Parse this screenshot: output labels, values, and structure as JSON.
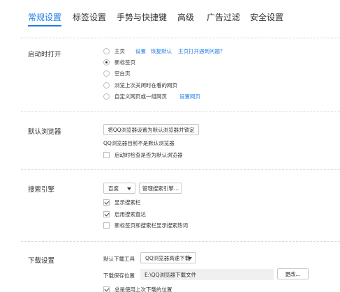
{
  "tabs": [
    {
      "label": "常规设置",
      "active": true
    },
    {
      "label": "标签设置",
      "active": false
    },
    {
      "label": "手势与快捷键",
      "active": false
    },
    {
      "label": "高级",
      "active": false
    },
    {
      "label": "广告过滤",
      "active": false
    },
    {
      "label": "安全设置",
      "active": false
    }
  ],
  "accent_color": "#1e7be8",
  "startup": {
    "title": "启动时打开",
    "options": [
      {
        "label": "主页",
        "checked": false
      },
      {
        "label": "新标签页",
        "checked": true
      },
      {
        "label": "空白页",
        "checked": false
      },
      {
        "label": "浏览上次关闭时在看的网页",
        "checked": false
      },
      {
        "label": "自定义网页或一组网页",
        "checked": false
      }
    ],
    "home_links": {
      "settings": "设置",
      "restore_default": "恢复默认",
      "help": "主页打开遇到问题？"
    },
    "custom_settings_link": "设置网页"
  },
  "default_browser": {
    "title": "默认浏览器",
    "button": "将QQ浏览器设置为默认浏览器并锁定",
    "status": "QQ浏览器目前不是默认浏览器",
    "check_on_startup": {
      "label": "启动时检查是否为默认浏览器",
      "checked": false
    }
  },
  "search": {
    "title": "搜索引擎",
    "engine": "百度",
    "manage_button": "管理搜索引擎...",
    "options": [
      {
        "label": "显示搜索栏",
        "checked": true
      },
      {
        "label": "启用搜索直达",
        "checked": true
      },
      {
        "label": "新标签页和搜索栏显示搜索热词",
        "checked": false
      }
    ]
  },
  "download": {
    "title": "下载设置",
    "tool_label": "默认下载工具",
    "tool_value": "QQ浏览器高速下载",
    "path_label": "下载保存位置",
    "path_value": "E:\\QQ浏览器下载文件",
    "change_button": "更改...",
    "always_last": {
      "label": "总是使用上次下载的位置",
      "checked": true
    }
  }
}
